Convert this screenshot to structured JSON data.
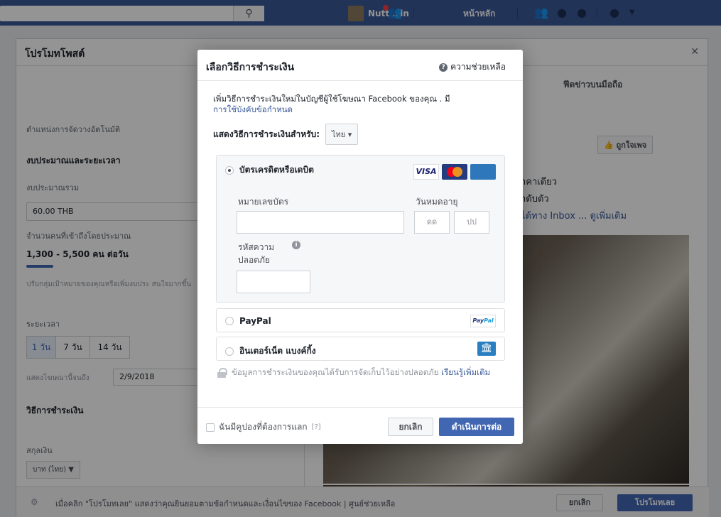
{
  "topbar": {
    "profile_name": "Nuttasin",
    "home_label": "หน้าหลัก"
  },
  "background": {
    "modal_title": "โปรโมทโพสต์",
    "mobile_feed_tab": "ฟีดข่าวบนมือถือ",
    "auto_placement": "ตำแหน่งการจัดวางอัตโนมัติ",
    "budget_section": "งบประมาณและระยะเวลา",
    "total_budget_label": "งบประมาณรวม",
    "total_budget_value": "60.00 THB",
    "reach_label": "จำนวนคนที่เข้าถึงโดยประมาณ",
    "reach_value": "1,300 - 5,500 คน ต่อวัน",
    "reach_hint": "ปรับกลุ่มเป้าหมายของคุณหรือเพิ่มงบประ สนใจมากขึ้น",
    "duration_label": "ระยะเวลา",
    "durations": [
      "1 วัน",
      "7 วัน",
      "14 วัน"
    ],
    "show_until_label": "แสดงโฆษณานี้จนถึง",
    "show_until_date": "2/9/2018",
    "payment_section": "วิธีการชำระเงิน",
    "currency_label": "สกุลเงิน",
    "currency_value": "บาท (ไทย)",
    "like_page": "ถูกใจเพจ",
    "right_line1": "าคาเดียว",
    "right_line2": "าดับตัว",
    "right_line3": "ได้ทาง Inbox ... ดูเพิ่มเติม",
    "footer_text": "เมื่อคลิก \"โปรโมทเลย\" แสดงว่าคุณยินยอมตามข้อกำหนดและเงื่อนไขของ Facebook | ศูนย์ช่วยเหลือ",
    "footer_cancel": "ยกเลิก",
    "footer_promote": "โปรโมทเลย"
  },
  "dialog": {
    "title": "เลือกวิธีการชำระเงิน",
    "help": "ความช่วยเหลือ",
    "desc": "เพิ่มวิธีการชำระเงินใหม่ในบัญชีผู้ใช้โฆษณา Facebook ของคุณ . มี",
    "desc_link": "การใช้บังคับข้อกำหนด",
    "show_for_label": "แสดงวิธีการชำระเงินสำหรับ:",
    "language": "ไทย",
    "card_option": "บัตรเครดิตหรือเดบิต",
    "card_brands": {
      "visa": "VISA"
    },
    "card_number_label": "หมายเลขบัตร",
    "expiry_label": "วันหมดอายุ",
    "expiry_month_ph": "ดด",
    "expiry_year_ph": "ปป",
    "security_label_1": "รหัสความ",
    "security_label_2": "ปลอดภัย",
    "paypal_option": "PayPal",
    "paypal_logo_a": "Pay",
    "paypal_logo_b": "Pal",
    "bank_option": "อินเตอร์เน็ต แบงค์กิ้ง",
    "secure_text": "ข้อมูลการชำระเงินของคุณได้รับการจัดเก็บไว้อย่างปลอดภัย",
    "secure_link": "เรียนรู้เพิ่มเติม",
    "coupon_label": "ฉันมีคูปองที่ต้องการแลก",
    "coupon_hint": "[?]",
    "cancel": "ยกเลิก",
    "continue": "ดำเนินการต่อ"
  },
  "colors": {
    "brand": "#3b5998",
    "primary_button": "#4267b2",
    "link": "#365899"
  }
}
